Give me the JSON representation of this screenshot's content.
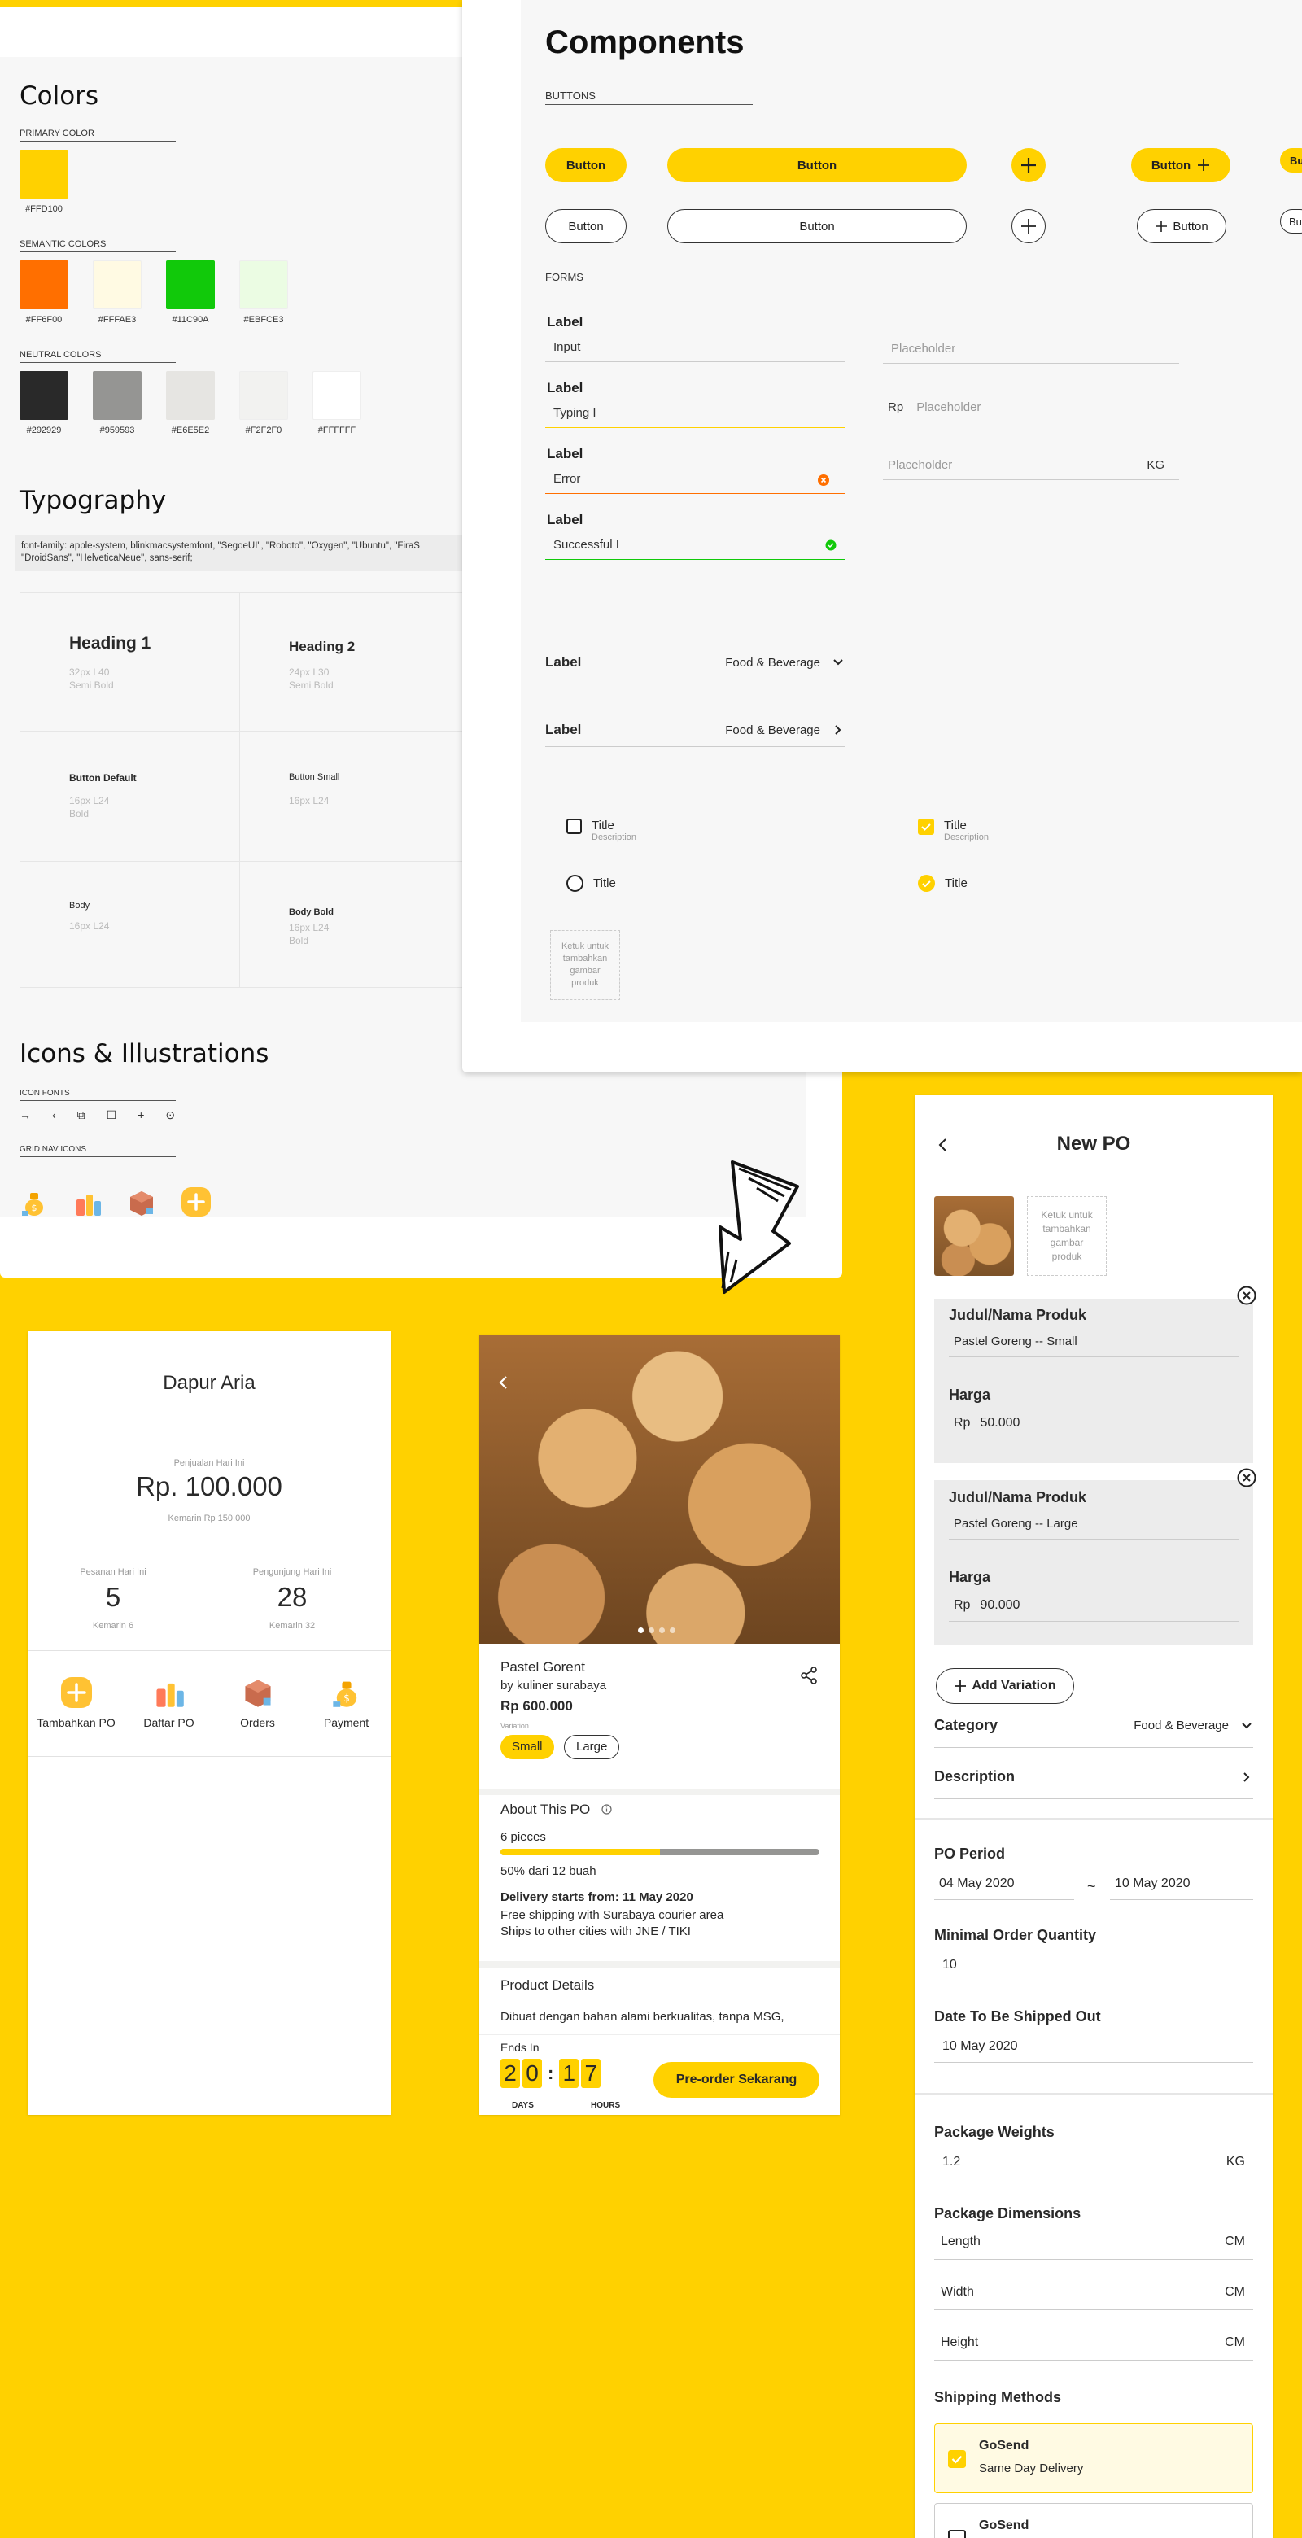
{
  "colors_panel": {
    "title": "Colors",
    "primary_label": "PRIMARY COLOR",
    "semantic_label": "SEMANTIC COLORS",
    "neutral_label": "NEUTRAL COLORS",
    "primary": [
      {
        "hex": "#FFD100",
        "label": "#FFD100"
      }
    ],
    "semantic": [
      {
        "hex": "#FF6F00",
        "label": "#FF6F00"
      },
      {
        "hex": "#FFFAE3",
        "label": "#FFFAE3"
      },
      {
        "hex": "#11C90A",
        "label": "#11C90A"
      },
      {
        "hex": "#EBFCE3",
        "label": "#EBFCE3"
      }
    ],
    "neutral": [
      {
        "hex": "#292929",
        "label": "#292929"
      },
      {
        "hex": "#959593",
        "label": "#959593"
      },
      {
        "hex": "#E6E5E2",
        "label": "#E6E5E2"
      },
      {
        "hex": "#F2F2F0",
        "label": "#F2F2F0"
      },
      {
        "hex": "#FFFFFF",
        "label": "#FFFFFF"
      }
    ]
  },
  "typography": {
    "title": "Typography",
    "font_family": "font-family: apple-system, blinkmacsystemfont, \"SegoeUI\", \"Roboto\", \"Oxygen\", \"Ubuntu\", \"FiraS",
    "font_family_2": "\"DroidSans\", \"HelveticaNeue\", sans-serif;",
    "cells": [
      {
        "name": "Heading 1",
        "spec": "32px L40",
        "weight": "Semi Bold"
      },
      {
        "name": "Heading 2",
        "spec": "24px L30",
        "weight": "Semi Bold"
      },
      {
        "name": "Button Default",
        "spec": "16px L24",
        "weight": "Bold"
      },
      {
        "name": "Button Small",
        "spec": "16px L24",
        "weight": ""
      },
      {
        "name": "Body",
        "spec": "16px L24",
        "weight": ""
      },
      {
        "name": "Body Bold",
        "spec": "16px L24",
        "weight": "Bold"
      }
    ]
  },
  "icons": {
    "title": "Icons & Illustrations",
    "icon_fonts_label": "ICON FONTS",
    "grid_nav_label": "GRID NAV ICONS",
    "glyphs": [
      "→",
      "‹",
      "⧉",
      "☐",
      "+",
      "⊙"
    ]
  },
  "components": {
    "title": "Components",
    "buttons_label": "BUTTONS",
    "forms_label": "FORMS",
    "btn": "Button",
    "btn_plus": "Button",
    "btn_cut": "Bu",
    "btn_cut2": "Bu",
    "labels": {
      "label": "Label",
      "input": "Input",
      "typing": "Typing I",
      "error": "Error",
      "success": "Successful I",
      "placeholder": "Placeholder",
      "rp": "Rp",
      "kg": "KG",
      "food": "Food & Beverage",
      "title": "Title",
      "description": "Description",
      "upload": "Ketuk untuk tambahkan gambar produk"
    }
  },
  "dashboard": {
    "store": "Dapur Aria",
    "sales_label": "Penjualan Hari Ini",
    "sales": "Rp. 100.000",
    "sales_yesterday": "Kemarin Rp 150.000",
    "orders_label": "Pesanan Hari Ini",
    "orders": "5",
    "orders_yesterday": "Kemarin 6",
    "visitors_label": "Pengunjung Hari Ini",
    "visitors": "28",
    "visitors_yesterday": "Kemarin 32",
    "nav": [
      {
        "label": "Tambahkan PO",
        "icon": "plus-icon"
      },
      {
        "label": "Daftar PO",
        "icon": "products-icon"
      },
      {
        "label": "Orders",
        "icon": "box-icon"
      },
      {
        "label": "Payment",
        "icon": "money-bag-icon"
      }
    ]
  },
  "product": {
    "name": "Pastel Gorent",
    "seller": "by kuliner surabaya",
    "price": "Rp 600.000",
    "variation_label": "Variation",
    "variations": [
      "Small",
      "Large"
    ],
    "about_title": "About This PO",
    "pieces": "6 pieces",
    "progress": 0.5,
    "progress_text": "50% dari 12 buah",
    "delivery": "Delivery starts from: 11 May 2020",
    "shipping1": "Free shipping with Surabaya courier area",
    "shipping2": "Ships to other cities with JNE / TIKI",
    "details_title": "Product Details",
    "details_text": "Dibuat dengan bahan alami berkualitas, tanpa MSG,",
    "ends_in": "Ends In",
    "days": [
      "2",
      "0"
    ],
    "hours": [
      "1",
      "7"
    ],
    "days_label": "DAYS",
    "hours_label": "HOURS",
    "cta": "Pre-order Sekarang"
  },
  "new_po": {
    "title": "New PO",
    "upload": "Ketuk untuk tambahkan gambar produk",
    "variants": [
      {
        "name_label": "Judul/Nama Produk",
        "name": "Pastel Goreng -- Small",
        "price_label": "Harga",
        "rp": "Rp",
        "price": "50.000"
      },
      {
        "name_label": "Judul/Nama Produk",
        "name": "Pastel Goreng -- Large",
        "price_label": "Harga",
        "rp": "Rp",
        "price": "90.000"
      }
    ],
    "add_variation": "Add Variation",
    "category_label": "Category",
    "category": "Food & Beverage",
    "description_label": "Description",
    "period_label": "PO Period",
    "period_start": "04 May 2020",
    "tilde": "~",
    "period_end": "10 May 2020",
    "moq_label": "Minimal Order Quantity",
    "moq": "10",
    "ship_date_label": "Date To Be Shipped Out",
    "ship_date": "10 May 2020",
    "weights_label": "Package Weights",
    "weight": "1.2",
    "kg": "KG",
    "dims_label": "Package Dimensions",
    "length": "Length",
    "width": "Width",
    "height": "Height",
    "cm": "CM",
    "shipping_label": "Shipping Methods",
    "gosend": "GoSend",
    "same_day": "Same Day Delivery",
    "gosend2": "GoSend"
  }
}
